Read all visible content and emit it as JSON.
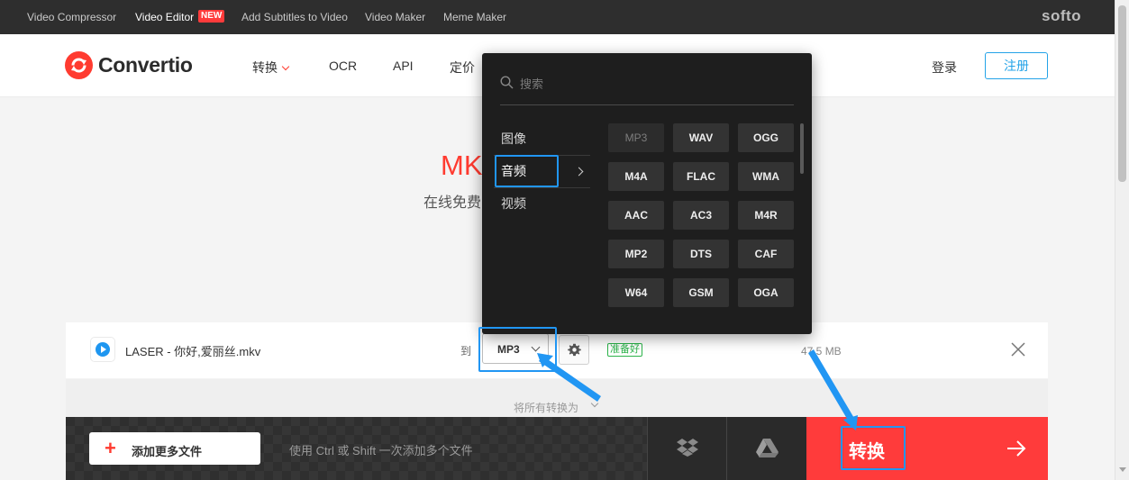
{
  "topbar": {
    "links": [
      "Video Compressor",
      "Video Editor",
      "Add Subtitles to Video",
      "Video Maker",
      "Meme Maker"
    ],
    "new_badge": "NEW",
    "brand": "softo"
  },
  "header": {
    "logo_text": "Convertio",
    "nav": [
      "转换",
      "OCR",
      "API",
      "定价"
    ],
    "login": "登录",
    "signup": "注册"
  },
  "hero": {
    "title": "MK",
    "subtitle": "在线免费"
  },
  "file": {
    "name": "LASER - 你好,爱丽丝.mkv",
    "to_label": "到",
    "selected_format": "MP3",
    "status": "准备好",
    "size": "47.5 MB"
  },
  "convert_all": {
    "label": "将所有转换为"
  },
  "bottombar": {
    "add_more_label": "添加更多文件",
    "hint": "使用 Ctrl 或 Shift 一次添加多个文件",
    "convert_label": "转换"
  },
  "dropdown": {
    "search_placeholder": "搜索",
    "categories": [
      "图像",
      "音频",
      "视频"
    ],
    "selected_category": "音频",
    "formats": [
      "MP3",
      "WAV",
      "OGG",
      "M4A",
      "FLAC",
      "WMA",
      "AAC",
      "AC3",
      "M4R",
      "MP2",
      "DTS",
      "CAF",
      "W64",
      "GSM",
      "OGA"
    ],
    "disabled_format": "MP3"
  },
  "colors": {
    "accent_red": "#ff3b3b",
    "highlight_blue": "#2196f3",
    "signup_blue": "#24a3e8",
    "ready_green": "#2cb34a"
  }
}
